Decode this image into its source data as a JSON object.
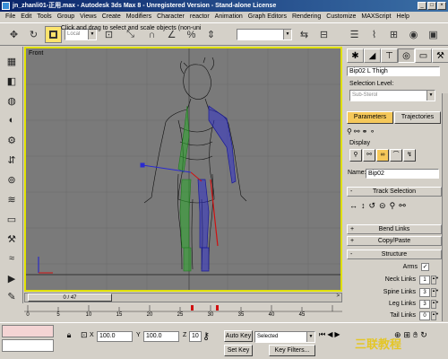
{
  "window": {
    "title": "jn_zhanli01-正用.max - Autodesk 3ds Max 8 - Unregistered Version - Stand-alone License",
    "minimize": "_",
    "maximize": "□",
    "close": "×"
  },
  "menu": [
    "File",
    "Edit",
    "Tools",
    "Group",
    "Views",
    "Create",
    "Modifiers",
    "Character",
    "reactor",
    "Animation",
    "Graph Editors",
    "Rendering",
    "Customize",
    "MAXScript",
    "Help"
  ],
  "toolbar": {
    "coord_system": "Local",
    "named_selection": ""
  },
  "viewport": {
    "label": "Front"
  },
  "timeline": {
    "frame_display": "0 / 47",
    "ticks": [
      "0",
      "5",
      "10",
      "15",
      "20",
      "25",
      "30",
      "35",
      "40",
      "45"
    ]
  },
  "command_panel": {
    "object_name": "Bip02 L Thigh",
    "selection_level_label": "Selection Level:",
    "selection_level_value": "Sub-Sterol",
    "tab_parameters": "Parameters",
    "tab_trajectories": "Trajectories",
    "display_label": "Display",
    "name_label": "Name:",
    "name_value": "Bip02",
    "track_selection": "Track Selection",
    "bend_links": "Bend Links",
    "copy_paste": "Copy/Paste",
    "structure": "Structure",
    "arms_label": "Arms",
    "neck_links_label": "Neck Links",
    "neck_links_value": "1",
    "spine_links_label": "Spine Links",
    "spine_links_value": "3",
    "leg_links_label": "Leg Links",
    "leg_links_value": "3",
    "tail_links_label": "Tail Links",
    "tail_links_value": "0"
  },
  "status": {
    "prompt": "Click and drag to select and scale objects (non-uni",
    "x_label": "X",
    "x_value": "100.0",
    "y_label": "Y",
    "y_value": "100.0",
    "z_label": "Z",
    "z_value": "10",
    "auto_key": "Auto Key",
    "set_key": "Set Key",
    "key_mode": "Selected",
    "key_filters": "Key Filters..."
  },
  "colors": {
    "title_bar": "#0a246a",
    "viewport_bg": "#7a7a7a",
    "viewport_border": "#e0e000",
    "active_button": "#f5c85a",
    "biped_left": "#2aa82a",
    "biped_right": "#2a2ad0"
  }
}
